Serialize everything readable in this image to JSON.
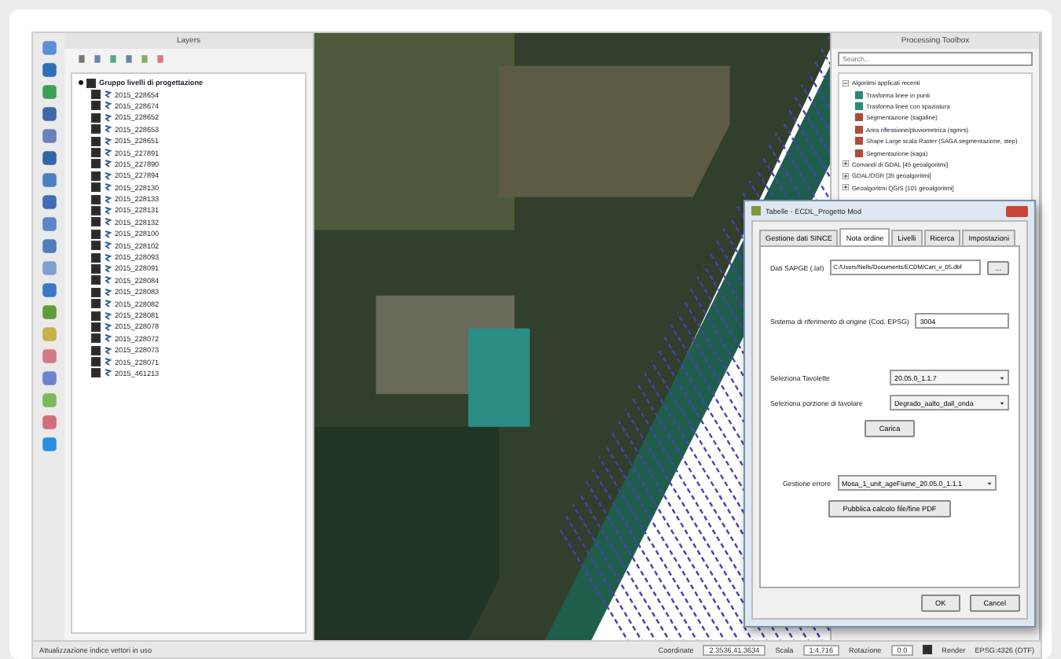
{
  "layers_panel": {
    "title": "Layers",
    "tree": [
      {
        "label": "Gruppo livelli di progettazione",
        "checked": true,
        "expanded": true,
        "children": [
          {
            "label": "2015_228654",
            "checked": true
          },
          {
            "label": "2015_228674",
            "checked": true
          },
          {
            "label": "2015_228652",
            "checked": true
          },
          {
            "label": "2015_228653",
            "checked": true
          },
          {
            "label": "2015_228651",
            "checked": true
          },
          {
            "label": "2015_227891",
            "checked": true
          },
          {
            "label": "2015_227890",
            "checked": true
          },
          {
            "label": "2015_227894",
            "checked": true
          },
          {
            "label": "2015_228130",
            "checked": true
          },
          {
            "label": "2015_228133",
            "checked": true
          },
          {
            "label": "2015_228131",
            "checked": true
          },
          {
            "label": "2015_228132",
            "checked": true
          },
          {
            "label": "2015_228100",
            "checked": true
          },
          {
            "label": "2015_228102",
            "checked": true
          },
          {
            "label": "2015_228093",
            "checked": true
          },
          {
            "label": "2015_228091",
            "checked": true
          },
          {
            "label": "2015_228084",
            "checked": true
          },
          {
            "label": "2015_228083",
            "checked": true
          },
          {
            "label": "2015_228082",
            "checked": true
          },
          {
            "label": "2015_228081",
            "checked": true
          },
          {
            "label": "2015_228078",
            "checked": true
          },
          {
            "label": "2015_228072",
            "checked": true
          },
          {
            "label": "2015_228073",
            "checked": true
          },
          {
            "label": "2015_228071",
            "checked": true
          },
          {
            "label": "2015_461213",
            "checked": true
          }
        ]
      }
    ]
  },
  "processing_panel": {
    "title": "Processing Toolbox",
    "search": {
      "placeholder": "Search..."
    },
    "tree": [
      {
        "label": "Algoritmi applicati recenti",
        "expanded": true,
        "children": [
          {
            "label": "Trasforma linee in punti",
            "color": "#2a8a7a"
          },
          {
            "label": "Trasforma linee con spaziatura",
            "color": "#2a8a7a"
          },
          {
            "label": "Segmentazione (sagafine)",
            "color": "#b04a3a"
          },
          {
            "label": "Area riflessione/pluviometrica (sgmrs)",
            "color": "#b04a3a"
          },
          {
            "label": "Shape Large scala Raster (SAGA segmentazione, step)",
            "color": "#b04a3a"
          },
          {
            "label": "Segmentazione (saga)",
            "color": "#b04a3a"
          }
        ]
      },
      {
        "label": "Comandi di GDAL [45 geoalgoritmi]",
        "expanded": false
      },
      {
        "label": "GDAL/OGR [35 geoalgoritmi]",
        "expanded": false
      },
      {
        "label": "Geoalgoritmi QGIS [101 geoalgoritmi]",
        "expanded": false
      }
    ]
  },
  "dialog": {
    "title": "Tabelle - ECDL_Progetto Mod",
    "tabs": [
      {
        "label": "Gestione dati SINCE",
        "selected": false
      },
      {
        "label": "Nota ordine",
        "selected": true
      },
      {
        "label": "Livelli",
        "selected": false
      },
      {
        "label": "Ricerca",
        "selected": false
      },
      {
        "label": "Impostazioni",
        "selected": false
      }
    ],
    "source_file": {
      "label": "Dati SAPGE (.lat)",
      "value": "C:/Users/Nells/Documents/ECDM/Cart_v_05.dbf",
      "browse": "..."
    },
    "epsg": {
      "label": "Sistema di riferimento di origine (Cod. EPSG)",
      "value": "3004"
    },
    "sheet": {
      "label": "Seleziona Tavolette",
      "value": "20.05.0_1.1.7"
    },
    "portion": {
      "label": "Seleziona porzione di tavolare",
      "value": "Degrado_aalto_dall_onda"
    },
    "load_button": "Carica",
    "error": {
      "label": "Gestione errore",
      "value": "Mosa_1_unit_ageFiume_20.05.0_1.1.1"
    },
    "publish_button": "Pubblica calcolo file/fine PDF",
    "buttons": [
      "OK",
      "Cancel"
    ]
  },
  "status_bar": {
    "message": "Attualizzazione indice vettori in uso",
    "coordinate_label": "Coordinate",
    "coordinate": "2.3536,41.3634",
    "scale_label": "Scala",
    "scale": "1:4,716",
    "rotation_label": "Rotazione",
    "rotation": "0.0",
    "render": {
      "label": "Render",
      "checked": true
    },
    "crs": "EPSG:4326 (OTF)"
  }
}
